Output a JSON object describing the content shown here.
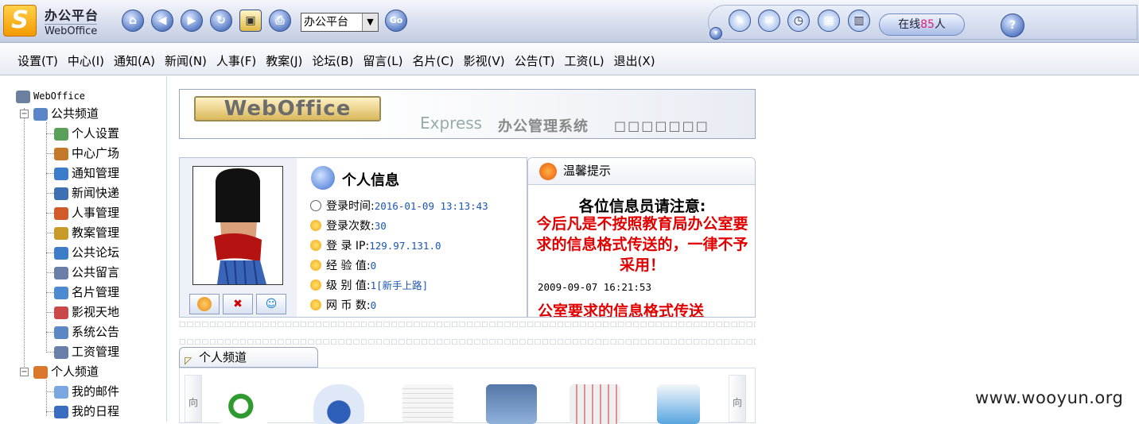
{
  "topbar": {
    "logo_letter": "S",
    "brand_cn": "办公平台",
    "brand_en": "WebOffice",
    "nav_icons": [
      "home-icon",
      "back-icon",
      "forward-icon",
      "refresh-icon",
      "bookmark-icon",
      "print-icon"
    ],
    "channel_select": "办公平台",
    "go_label": "Go",
    "tool_icons": [
      "notes-icon",
      "message-icon",
      "clock-icon",
      "folder-icon",
      "book-icon"
    ],
    "online_prefix": "在线",
    "online_count": "85",
    "online_suffix": "人",
    "help_label": "?"
  },
  "menu": [
    "设置(T)",
    "中心(I)",
    "通知(A)",
    "新闻(N)",
    "人事(F)",
    "教案(J)",
    "论坛(B)",
    "留言(L)",
    "名片(C)",
    "影视(V)",
    "公告(T)",
    "工资(L)",
    "退出(X)"
  ],
  "tree": {
    "root": "WebOffice",
    "public_channel": "公共频道",
    "public_items": [
      "个人设置",
      "中心广场",
      "通知管理",
      "新闻快递",
      "人事管理",
      "教案管理",
      "公共论坛",
      "公共留言",
      "名片管理",
      "影视天地",
      "系统公告",
      "工资管理"
    ],
    "personal_channel": "个人频道",
    "personal_items": [
      "我的邮件",
      "我的日程"
    ]
  },
  "banner": {
    "logo": "WebOffice",
    "express": "Express",
    "system": "办公管理系统",
    "boxes": "□□□□□□□"
  },
  "info": {
    "title": "个人信息",
    "rows": [
      {
        "label": "登录时间:",
        "value": "2016-01-09 13:13:43"
      },
      {
        "label": "登录次数:",
        "value": "30"
      },
      {
        "label": "登 录 IP:",
        "value": "129.97.131.0"
      },
      {
        "label": "经 验 值:",
        "value": "0"
      },
      {
        "label": "级 别 值:",
        "value": "1[新手上路]"
      },
      {
        "label": "网 币 数:",
        "value": "0"
      }
    ]
  },
  "notice": {
    "title": "温馨提示",
    "heading": "各位信息员请注意:",
    "body": "今后凡是不按照教育局办公室要求的信息格式传送的，一律不予采用！",
    "time": "2009-09-07 16:21:53",
    "scroll_next": "公室要求的信息格式传送"
  },
  "separator": "□□□□□□□□□□□□□□□□□□□□□□□□□□□□□□□□□□□□□□□□□□□□□□□□□□□□□□□□□□□□□□□□□□□□□□□□□□□□□□□□□□□",
  "personal_channel": {
    "tab_label": "个人频道",
    "left_arrow": "向",
    "right_arrow": "向",
    "icons": [
      "email-icon",
      "clock-icon",
      "document-icon",
      "gallery-icon",
      "newspaper-icon",
      "image-file-icon"
    ]
  },
  "watermark": "www.wooyun.org"
}
